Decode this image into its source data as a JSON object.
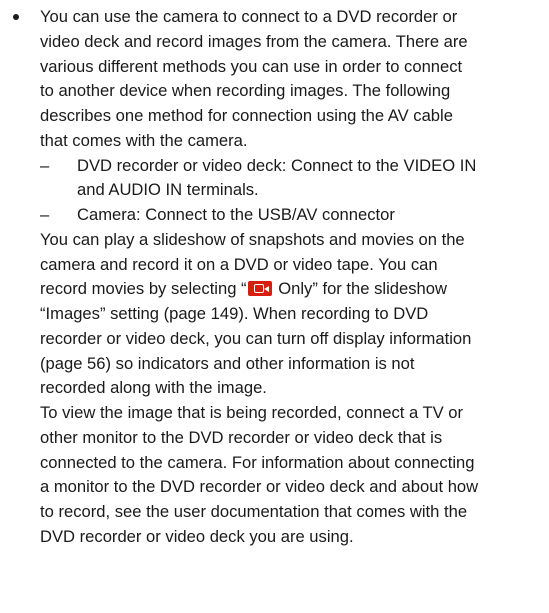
{
  "bullet": {
    "lines": [
      "You can use the camera to connect to a DVD recorder or",
      "video deck and record images from the camera. There are",
      "various different methods you can use in order to connect",
      "to another device when recording images. The following",
      "describes one method for connection using the AV cable",
      "that comes with the camera."
    ],
    "sub_items": [
      {
        "dash": "–",
        "lines": [
          "DVD recorder or video deck: Connect to the VIDEO IN",
          "and AUDIO IN terminals."
        ]
      },
      {
        "dash": "–",
        "lines": [
          "Camera: Connect to the USB/AV connector"
        ]
      }
    ],
    "para2": {
      "line1": "You can play a slideshow of snapshots and movies on the",
      "line2": "camera and record it on a DVD or video tape. You can",
      "line3_before_icon": "record movies by selecting “",
      "movie_icon": "movie-icon",
      "line3_after_icon": " Only” for the slideshow",
      "rest": [
        "“Images” setting (page 149). When recording to DVD",
        "recorder or video deck, you can turn off display information",
        "(page 56) so indicators and other information is not",
        "recorded along with the image."
      ]
    },
    "para3": [
      "To view the image that is being recorded, connect a TV or",
      "other monitor to the DVD recorder or video deck that is",
      "connected to the camera. For information about connecting",
      "a monitor to the DVD recorder or video deck and about how",
      "to record, see the user documentation that comes with the",
      "DVD recorder or video deck you are using."
    ]
  },
  "colors": {
    "text": "#1a1a1a",
    "icon_red": "#d81e0f",
    "background": "#ffffff"
  }
}
